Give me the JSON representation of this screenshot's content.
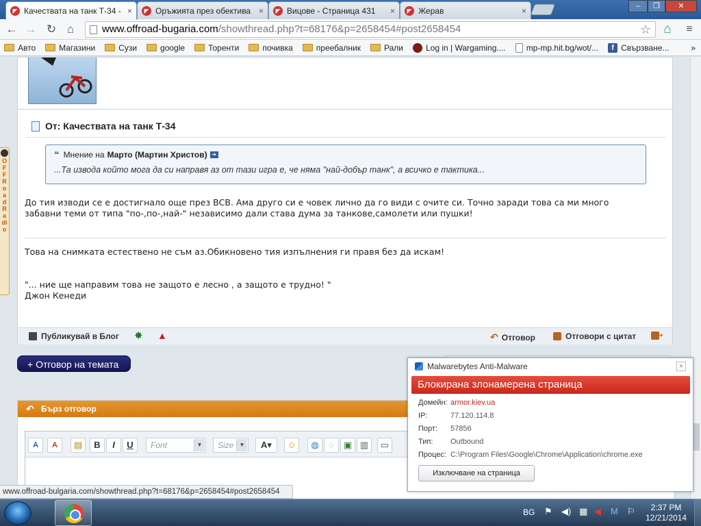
{
  "browser": {
    "tabs": [
      {
        "title": "Качествата на танк Т-34 -",
        "active": true
      },
      {
        "title": "Оръжията през обектива",
        "active": false
      },
      {
        "title": "Вицове - Страница 431",
        "active": false
      },
      {
        "title": "Жерав",
        "active": false
      }
    ],
    "tab_close": "×",
    "window_controls": {
      "minimize": "–",
      "maximize": "❐",
      "close": "✕"
    },
    "url_host": "www.offroad-bugaria.com",
    "url_rest": "/showthread.php?t=68176&p=2658454#post2658454",
    "bookmarks": [
      {
        "label": "Авто",
        "type": "folder"
      },
      {
        "label": "Магазини",
        "type": "folder"
      },
      {
        "label": "Сузи",
        "type": "folder"
      },
      {
        "label": "google",
        "type": "folder"
      },
      {
        "label": "Торенти",
        "type": "folder"
      },
      {
        "label": "почивка",
        "type": "folder"
      },
      {
        "label": "преебалник",
        "type": "folder"
      },
      {
        "label": "Рали",
        "type": "folder"
      },
      {
        "label": "Log in | Wargaming....",
        "type": "site"
      },
      {
        "label": "mp-mp.hit.bg/wot/...",
        "type": "page"
      },
      {
        "label": "Свързване...",
        "type": "facebook"
      }
    ],
    "bookmarks_more": "»",
    "status_url": "www.offroad-bulgaria.com/showthread.php?t=68176&p=2658454#post2658454"
  },
  "post": {
    "title": "От: Качествата на танк Т-34",
    "quote_prefix": "Мнение на",
    "quote_author": "Марто (Мартин Христов)",
    "quote_text": "...Та извода който мога да си направя аз от тази игра е, че няма \"най-добър танк\", а всичко е тактика...",
    "body_line1": "До тия изводи се е достигнало още през ВСВ. Ама друго си е човек лично да го види с очите си. Точно заради това са ми много",
    "body_line2": "забавни теми от типа \"по-,по-,най-\" независимо дали става дума за танкове,самолети или пушки!",
    "sig_line1": "Това на снимката естествено не съм аз.Обикновено тия изпълнения ги правя без да искам!",
    "sig_quote": "\"... ние ще направим това не защото е лесно , а защото е трудно! \"",
    "sig_author": "Джон Кенеди",
    "footer": {
      "blog": "Публикувай в Блог",
      "reply": "Отговор",
      "reply_quote": "Отговори с цитат"
    }
  },
  "radio": {
    "letters": "OFFRoadRadio"
  },
  "reply_button": "+ Отговор на темата",
  "quick_reply": {
    "title": "Бърз отговор",
    "font_placeholder": "Font",
    "size_placeholder": "Size"
  },
  "malwarebytes": {
    "app": "Malwarebytes Anti-Malware",
    "close": "×",
    "banner": "Блокирана злонамерена страница",
    "fields": [
      {
        "label": "Домейн:",
        "value": "armor.kiev.ua",
        "color": "#c0281b"
      },
      {
        "label": "IP:",
        "value": "77.120.114.8",
        "color": "#555555"
      },
      {
        "label": "Порт:",
        "value": "57856",
        "color": "#555555"
      },
      {
        "label": "Тип:",
        "value": "Outbound",
        "color": "#555555"
      },
      {
        "label": "Процес:",
        "value": "C:\\Program Files\\Google\\Chrome\\Application\\chrome.exe",
        "color": "#555555"
      }
    ],
    "exclude_button": "Изключване на страница"
  },
  "taskbar": {
    "lang": "BG",
    "time": "2:37 PM",
    "date": "12/21/2014"
  },
  "colors": {
    "tab_strip": "#2a5a98",
    "banner_red": "#d9362a",
    "reply_button": "#141650",
    "quick_reply_header": "#d47a12"
  }
}
